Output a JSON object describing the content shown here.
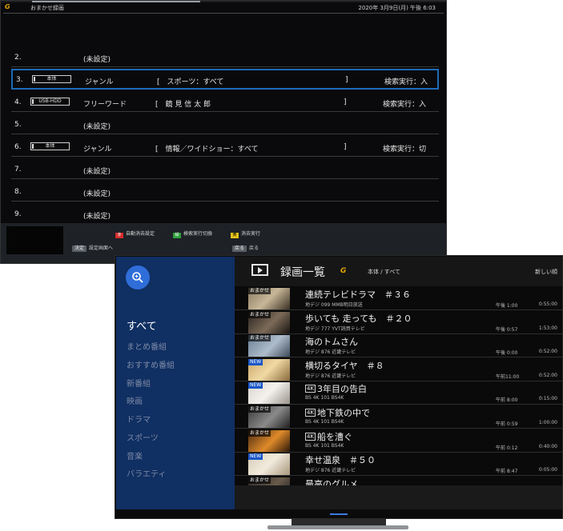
{
  "back_screen": {
    "logo": "G",
    "title": "おまかせ録画",
    "datetime": "2020年 3月9日(月) 午後 6:03",
    "rows": [
      {
        "num": "2.",
        "device": "",
        "type": "(未設定)",
        "keyword": "",
        "bracket": "",
        "exec": ""
      },
      {
        "num": "3.",
        "device": "本体",
        "type": "ジャンル",
        "keyword": "[　スポーツ：すべて",
        "bracket": "]",
        "exec": "検索実行：入"
      },
      {
        "num": "4.",
        "device": "USB-HDD",
        "type": "フリーワード",
        "keyword": "[　鏡 見 信 太 郎",
        "bracket": "]",
        "exec": "検索実行：入"
      },
      {
        "num": "5.",
        "device": "",
        "type": "(未設定)",
        "keyword": "",
        "bracket": "",
        "exec": ""
      },
      {
        "num": "6.",
        "device": "本体",
        "type": "ジャンル",
        "keyword": "[　情報／ワイドショー：すべて",
        "bracket": "]",
        "exec": "検索実行：切"
      },
      {
        "num": "7.",
        "device": "",
        "type": "(未設定)",
        "keyword": "",
        "bracket": "",
        "exec": ""
      },
      {
        "num": "8.",
        "device": "",
        "type": "(未設定)",
        "keyword": "",
        "bracket": "",
        "exec": ""
      },
      {
        "num": "9.",
        "device": "",
        "type": "(未設定)",
        "keyword": "",
        "bracket": "",
        "exec": ""
      }
    ],
    "footer": {
      "red_key": "赤",
      "red_label": "自動消去設定",
      "green_key": "緑",
      "green_label": "検索実行切換",
      "yellow_key": "黄",
      "yellow_label": "消去実行",
      "enter_key": "決定",
      "enter_label": "設定画面へ",
      "back_key": "戻る",
      "back_label": "戻る"
    },
    "colors": {
      "selection": "#1d6bb8",
      "red": "#d42a2a",
      "green": "#2e9e3c",
      "yellow": "#e6c21a"
    }
  },
  "front_screen": {
    "sidebar": {
      "categories": [
        "すべて",
        "まとめ番組",
        "おすすめ番組",
        "新番組",
        "映画",
        "ドラマ",
        "スポーツ",
        "音楽",
        "バラエティ"
      ]
    },
    "header": {
      "title": "録画一覧",
      "logo": "G",
      "breadcrumb": "本体 / すべて",
      "sort": "新しい順"
    },
    "programs": [
      {
        "badge": "おまかせ",
        "title": "連続テレビドラマ　＃３６",
        "k4": "",
        "channel": "地デジ 099 MMB明日放送",
        "time": "午後 1:00",
        "duration": "0:55:00"
      },
      {
        "badge": "おまかせ",
        "title": "歩いても 走っても　＃２０",
        "k4": "",
        "channel": "地デジ 777 YVT読買テレビ",
        "time": "午後 0:57",
        "duration": "1:53:00"
      },
      {
        "badge": "おまかせ",
        "title": "海のトムさん",
        "k4": "",
        "channel": "地デジ 876 近畿テレビ",
        "time": "午後 0:00",
        "duration": "0:52:00"
      },
      {
        "badge": "NEW",
        "title": "横切るタイヤ　＃８",
        "k4": "",
        "channel": "地デジ 876 近畿テレビ",
        "time": "午前11:00",
        "duration": "0:52:00"
      },
      {
        "badge": "NEW",
        "title": "3年目の告白",
        "k4": "4K",
        "channel": "BS 4K 101 BS4K",
        "time": "午前 8:00",
        "duration": "0:15:00"
      },
      {
        "badge": "おまかせ",
        "title": "地下鉄の中で",
        "k4": "4K",
        "channel": "BS 4K 101 BS4K",
        "time": "午前 0:59",
        "duration": "1:00:00"
      },
      {
        "badge": "おまかせ",
        "title": "船を漕ぐ",
        "k4": "4K",
        "channel": "BS 4K 101 BS4K",
        "time": "午前 0:12",
        "duration": "0:40:00"
      },
      {
        "badge": "NEW",
        "title": "幸せ温泉　＃５０",
        "k4": "",
        "channel": "地デジ 876 近畿テレビ",
        "time": "午前 8:47",
        "duration": "0:05:00"
      },
      {
        "badge": "おまかせ",
        "title": "最高のグルメ",
        "k4": "",
        "channel": "",
        "time": "",
        "duration": ""
      }
    ],
    "colors": {
      "sidebar": "#102f62",
      "search_button": "#2f6ed9",
      "new_badge": "#1a57c8",
      "logo": "#e0a400"
    }
  }
}
